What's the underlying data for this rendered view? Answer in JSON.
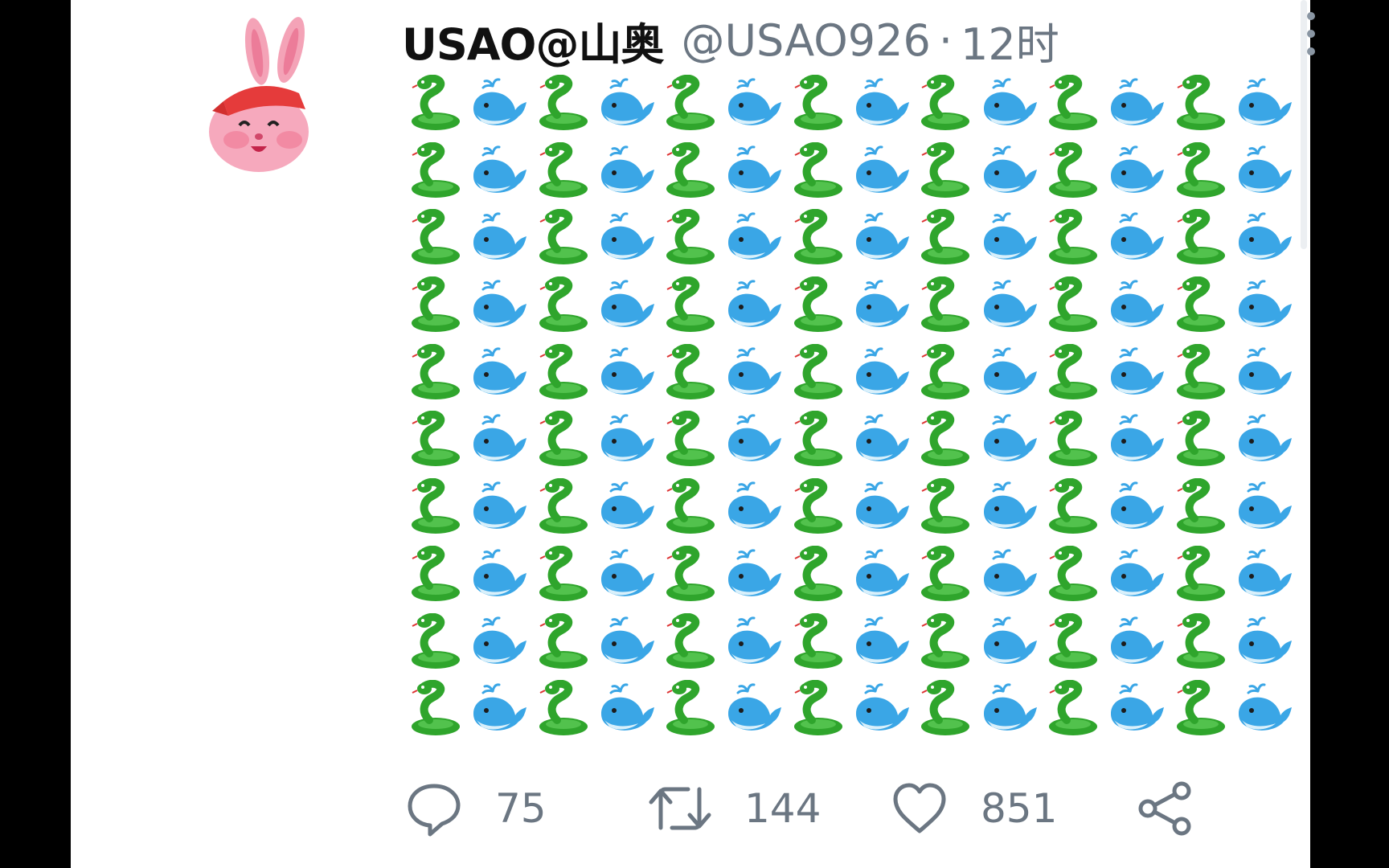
{
  "tweet": {
    "author_name": "USAO@山奥",
    "handle": "@USAO926",
    "separator": "·",
    "time": "12时",
    "emoji_rows": 10,
    "emoji_pattern": [
      "snake",
      "whale",
      "snake",
      "whale",
      "snake",
      "whale",
      "snake",
      "whale",
      "snake",
      "whale",
      "snake",
      "whale",
      "snake",
      "whale"
    ],
    "icons": {
      "avatar": "rabbit-avatar-icon",
      "more": "more-vertical-icon",
      "reply": "reply-bubble-icon",
      "retweet": "retweet-icon",
      "like": "heart-icon",
      "share": "share-icon"
    },
    "stats": {
      "replies": "75",
      "retweets": "144",
      "likes": "851"
    }
  },
  "colors": {
    "text_primary": "#111111",
    "text_secondary": "#6b7682",
    "snake": "#2fa52c",
    "whale": "#3aa6e6"
  }
}
